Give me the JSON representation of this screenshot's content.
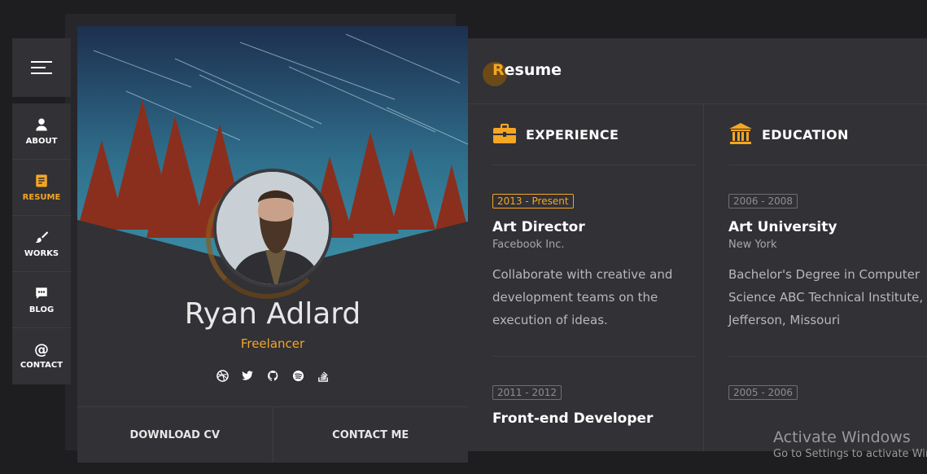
{
  "nav": {
    "items": [
      {
        "label": "ABOUT",
        "icon": "user-icon"
      },
      {
        "label": "RESUME",
        "icon": "document-icon",
        "active": true
      },
      {
        "label": "WORKS",
        "icon": "brush-icon"
      },
      {
        "label": "BLOG",
        "icon": "chat-icon"
      },
      {
        "label": "CONTACT",
        "icon": "at-icon"
      }
    ]
  },
  "profile": {
    "name": "Ryan Adlard",
    "role": "Freelancer",
    "social": [
      "dribbble-icon",
      "twitter-icon",
      "github-icon",
      "spotify-icon",
      "stackoverflow-icon"
    ],
    "download_label": "DOWNLOAD CV",
    "contact_label": "CONTACT ME"
  },
  "resume": {
    "title_first": "R",
    "title_rest": "esume",
    "experience": {
      "heading": "EXPERIENCE",
      "entries": [
        {
          "period": "2013 - Present",
          "title": "Art Director",
          "org": "Facebook Inc.",
          "desc": "Collaborate with creative and development teams on the execution of ideas."
        },
        {
          "period": "2011 - 2012",
          "title": "Front-end Developer",
          "org": "",
          "desc": ""
        }
      ]
    },
    "education": {
      "heading": "EDUCATION",
      "entries": [
        {
          "period": "2006 - 2008",
          "title": "Art University",
          "org": "New York",
          "desc": "Bachelor's Degree in Computer Science ABC Technical Institute, Jefferson, Missouri"
        },
        {
          "period": "2005 - 2006",
          "title": "",
          "org": "",
          "desc": ""
        }
      ]
    }
  },
  "watermark": {
    "line1": "Activate Windows",
    "line2": "Go to Settings to activate Windows."
  },
  "colors": {
    "accent": "#f5a623",
    "panel": "#313136",
    "background": "#1e1e21"
  }
}
